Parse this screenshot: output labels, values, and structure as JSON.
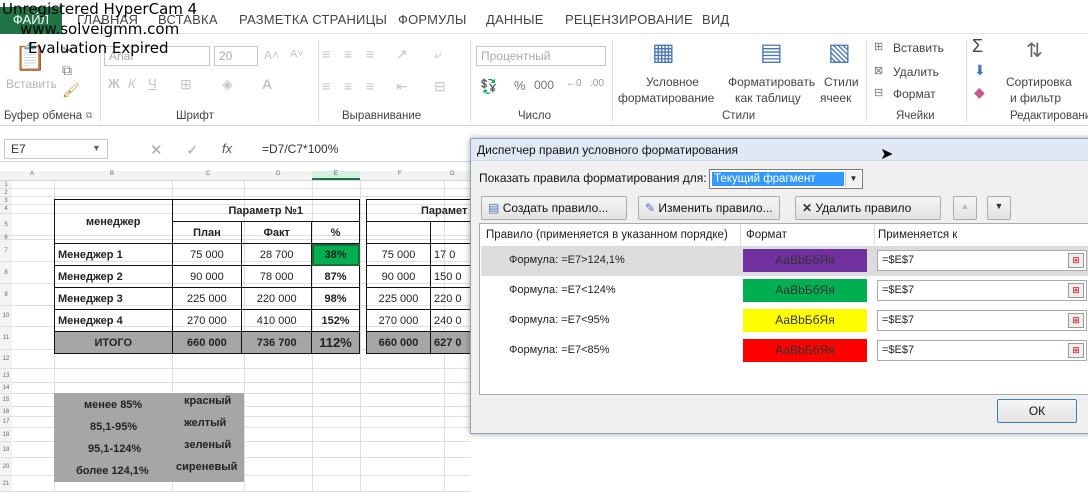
{
  "ribbon": {
    "tabs": [
      "ФАЙЛ",
      "ГЛАВНАЯ",
      "ВСТАВКА",
      "РАЗМЕТКА СТРАНИЦЫ",
      "ФОРМУЛЫ",
      "ДАННЫЕ",
      "РЕЦЕНЗИРОВАНИЕ",
      "ВИД"
    ],
    "paste_label": "Вставить",
    "groups": [
      "Буфер обмена",
      "Шрифт",
      "Выравнивание",
      "Число",
      "Стили",
      "Ячейки",
      "Редактирование"
    ],
    "font_name": "Arial",
    "font_size": "20",
    "number_format": "Процентный",
    "cond_fmt": [
      "Условное",
      "форматирование"
    ],
    "fmt_table": [
      "Форматировать",
      "как таблицу"
    ],
    "cell_styles": [
      "Стили",
      "ячеек"
    ],
    "insert_label": "Вставить",
    "delete_label": "Удалить",
    "format_label": "Формат",
    "sort_label": [
      "Сортировка",
      "и фильтр"
    ]
  },
  "watermark": {
    "line1": "Unregistered HyperCam 4",
    "line2": "www.solveigmm.com",
    "line3": "Evaluation Expired"
  },
  "formula_bar": {
    "name_box": "E7",
    "fx": "fx",
    "formula": "=D7/C7*100%"
  },
  "sheet": {
    "row_numbers": [
      "1",
      "2",
      "3",
      "4",
      "5",
      "6",
      "7",
      "8",
      "9",
      "10",
      "11",
      "12",
      "13",
      "14",
      "15",
      "16",
      "17",
      "18",
      "19",
      "20",
      "21"
    ],
    "col_letters": [
      "A",
      "B",
      "C",
      "D",
      "E",
      "F",
      "G"
    ],
    "header_manager": "менеджер",
    "header_param": "Параметр №1",
    "header_param2": "Парамет",
    "sub_headers": [
      "План",
      "Факт",
      "%"
    ],
    "rows": [
      {
        "name": "Менеджер 1",
        "plan": "75 000",
        "fact": "28 700",
        "pct": "38%",
        "plan2": "75 000",
        "fact2": "17 0"
      },
      {
        "name": "Менеджер 2",
        "plan": "90 000",
        "fact": "78 000",
        "pct": "87%",
        "plan2": "90 000",
        "fact2": "150 0"
      },
      {
        "name": "Менеджер 3",
        "plan": "225 000",
        "fact": "220 000",
        "pct": "98%",
        "plan2": "225 000",
        "fact2": "220 0"
      },
      {
        "name": "Менеджер 4",
        "plan": "270 000",
        "fact": "410 000",
        "pct": "152%",
        "plan2": "270 000",
        "fact2": "240 0"
      }
    ],
    "total": {
      "name": "ИТОГО",
      "plan": "660 000",
      "fact": "736 700",
      "pct": "112%",
      "plan2": "660 000",
      "fact2": "627 0"
    },
    "legend": [
      {
        "range": "менее 85%",
        "color": "красный"
      },
      {
        "range": "85,1-95%",
        "color": "желтый"
      },
      {
        "range": "95,1-124%",
        "color": "зеленый"
      },
      {
        "range": "более 124,1%",
        "color": "сиреневый"
      }
    ]
  },
  "dialog": {
    "title": "Диспетчер правил условного форматирования",
    "show_label": "Показать правила форматирования для:",
    "scope": "Текущий фрагмент",
    "new_rule": "Создать правило...",
    "edit_rule": "Изменить правило...",
    "delete_rule": "Удалить правило",
    "col_rule": "Правило (применяется в указанном порядке)",
    "col_format": "Формат",
    "col_applies": "Применяется к",
    "rules": [
      {
        "formula": "Формула: =E7>124,1%",
        "preview": "АаВbБбЯя",
        "color": "#7030a0",
        "applies": "=$E$7"
      },
      {
        "formula": "Формула: =E7<124%",
        "preview": "АаВbБбЯя",
        "color": "#00b050",
        "applies": "=$E$7"
      },
      {
        "formula": "Формула: =E7<95%",
        "preview": "АаВbБбЯя",
        "color": "#ffff00",
        "applies": "=$E$7"
      },
      {
        "formula": "Формула: =E7<85%",
        "preview": "АаВbБбЯя",
        "color": "#ff0000",
        "applies": "=$E$7"
      }
    ],
    "ok": "ОК"
  },
  "colors": {
    "accent": "#217346",
    "green_cell": "#00b050",
    "total_fill": "#a6a6a6",
    "legend_fill": "#a6a6a6"
  }
}
